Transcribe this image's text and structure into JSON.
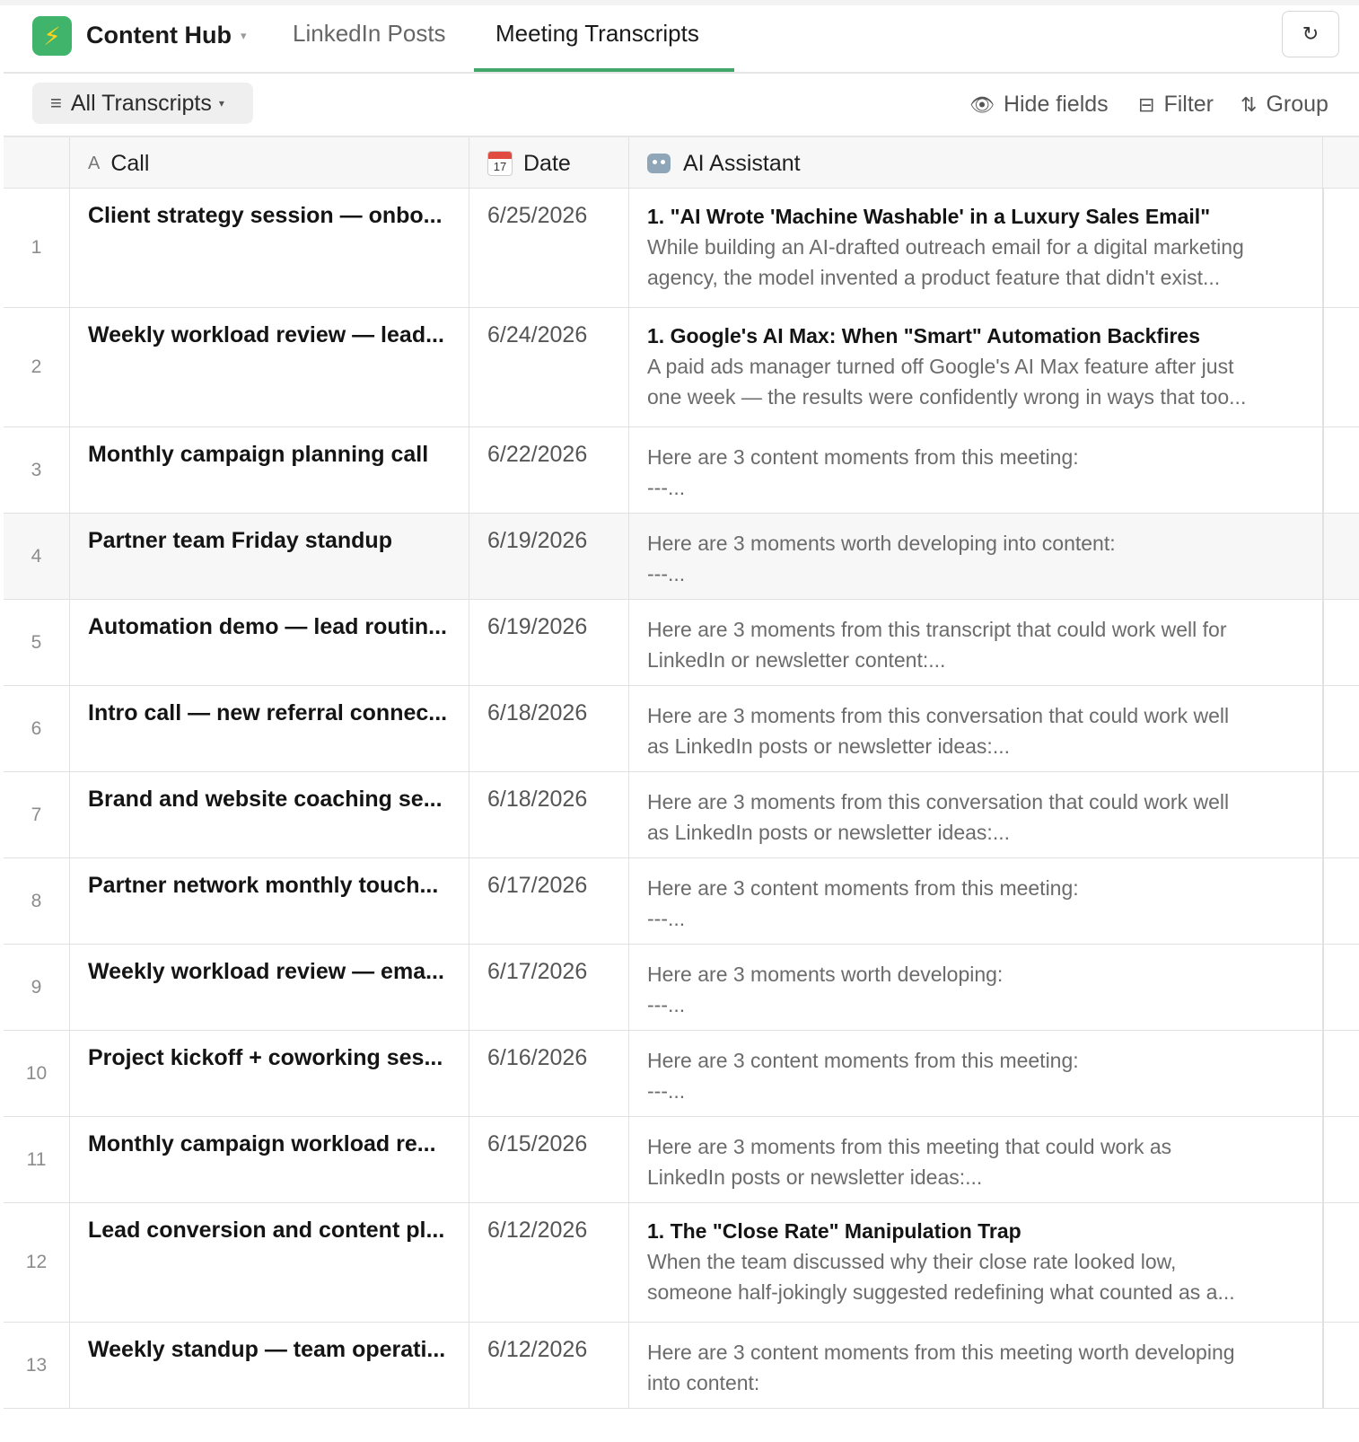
{
  "app": {
    "logo_glyph": "⚡",
    "title": "Content Hub",
    "caret": "▾",
    "brand_color": "#3fb46a"
  },
  "tabs": [
    {
      "label": "LinkedIn Posts",
      "active": false
    },
    {
      "label": "Meeting Transcripts",
      "active": true
    }
  ],
  "refresh": {
    "glyph": "↻"
  },
  "toolbar": {
    "view_label": "All Transcripts",
    "view_icon": "≡",
    "view_caret": "▾",
    "hide_icon": "👁",
    "hide_label": "Hide fields",
    "filter_icon": "⊟",
    "filter_label": "Filter",
    "group_icon": "⇅",
    "group_label": "Group"
  },
  "columns": {
    "call_icon": "A",
    "call": "Call",
    "date_icon_day": "17",
    "date": "Date",
    "ai": "AI Assistant"
  },
  "rows": [
    {
      "num": "1",
      "call": "Client strategy session — onbo...",
      "date": "6/25/2026",
      "ai_title": "1. \"AI Wrote 'Machine Washable' in a Luxury Sales Email\"",
      "ai_lines": [
        "While building an AI-drafted outreach email for a digital marketing",
        "agency, the model invented a product feature that didn't exist..."
      ]
    },
    {
      "num": "2",
      "call": "Weekly workload review — lead...",
      "date": "6/24/2026",
      "ai_title": "1. Google's AI Max: When \"Smart\" Automation Backfires",
      "ai_lines": [
        "A paid ads manager turned off Google's AI Max feature after just",
        "one week — the results were confidently wrong in ways that too..."
      ]
    },
    {
      "num": "3",
      "call": "Monthly campaign planning call",
      "date": "6/22/2026",
      "ai_title": "",
      "ai_lines": [
        "Here are 3 content moments from this meeting:",
        "---..."
      ]
    },
    {
      "num": "4",
      "call": "Partner team Friday standup",
      "date": "6/19/2026",
      "ai_title": "",
      "ai_lines": [
        "Here are 3 moments worth developing into content:",
        "---..."
      ]
    },
    {
      "num": "5",
      "call": "Automation demo — lead routin...",
      "date": "6/19/2026",
      "ai_title": "",
      "ai_lines": [
        "Here are 3 moments from this transcript that could work well for",
        "LinkedIn or newsletter content:..."
      ]
    },
    {
      "num": "6",
      "call": "Intro call — new referral connec...",
      "date": "6/18/2026",
      "ai_title": "",
      "ai_lines": [
        "Here are 3 moments from this conversation that could work well",
        "as LinkedIn posts or newsletter ideas:..."
      ]
    },
    {
      "num": "7",
      "call": "Brand and website coaching se...",
      "date": "6/18/2026",
      "ai_title": "",
      "ai_lines": [
        "Here are 3 moments from this conversation that could work well",
        "as LinkedIn posts or newsletter ideas:..."
      ]
    },
    {
      "num": "8",
      "call": "Partner network monthly touch...",
      "date": "6/17/2026",
      "ai_title": "",
      "ai_lines": [
        "Here are 3 content moments from this meeting:",
        "---..."
      ]
    },
    {
      "num": "9",
      "call": "Weekly workload review — ema...",
      "date": "6/17/2026",
      "ai_title": "",
      "ai_lines": [
        "Here are 3 moments worth developing:",
        "---..."
      ]
    },
    {
      "num": "10",
      "call": "Project kickoff + coworking ses...",
      "date": "6/16/2026",
      "ai_title": "",
      "ai_lines": [
        "Here are 3 content moments from this meeting:",
        "---..."
      ]
    },
    {
      "num": "11",
      "call": "Monthly campaign workload re...",
      "date": "6/15/2026",
      "ai_title": "",
      "ai_lines": [
        "Here are 3 moments from this meeting that could work as",
        "LinkedIn posts or newsletter ideas:..."
      ]
    },
    {
      "num": "12",
      "call": "Lead conversion and content pl...",
      "date": "6/12/2026",
      "ai_title": "1. The \"Close Rate\" Manipulation Trap",
      "ai_lines": [
        "When the team discussed why their close rate looked low,",
        "someone half-jokingly suggested redefining what counted as a..."
      ]
    },
    {
      "num": "13",
      "call": "Weekly standup — team operati...",
      "date": "6/12/2026",
      "ai_title": "",
      "ai_lines": [
        "Here are 3 content moments from this meeting worth developing",
        "into content:"
      ]
    }
  ]
}
